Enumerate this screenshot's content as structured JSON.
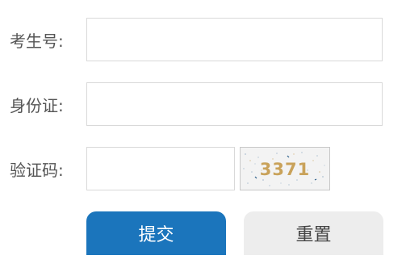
{
  "form": {
    "exam_number": {
      "label": "考生号:",
      "value": "",
      "placeholder": ""
    },
    "id_number": {
      "label": "身份证:",
      "value": "",
      "placeholder": ""
    },
    "captcha": {
      "label": "验证码:",
      "value": "",
      "placeholder": "",
      "image_text": "3371"
    }
  },
  "buttons": {
    "submit_label": "提交",
    "reset_label": "重置"
  },
  "colors": {
    "primary": "#1b75bc",
    "secondary": "#ededed",
    "border": "#d9d9d9",
    "label_text": "#555555",
    "captcha_digits": "#c9a25a"
  }
}
